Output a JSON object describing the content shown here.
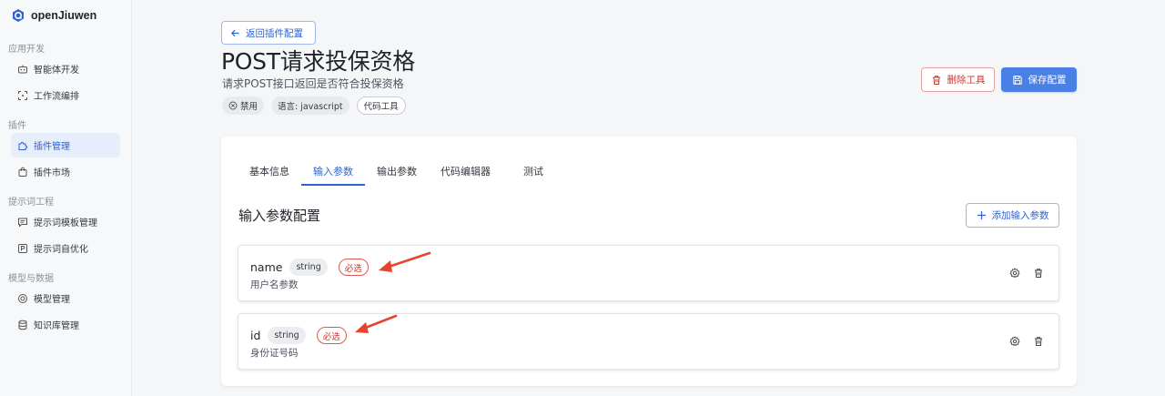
{
  "app": {
    "name": "openJiuwen"
  },
  "sidebar": {
    "groups": [
      {
        "label": "应用开发",
        "items": [
          {
            "label": "智能体开发",
            "icon": "robot-icon"
          },
          {
            "label": "工作流编排",
            "icon": "workflow-icon"
          }
        ]
      },
      {
        "label": "插件",
        "items": [
          {
            "label": "插件管理",
            "icon": "plugin-icon",
            "active": true
          },
          {
            "label": "插件市场",
            "icon": "shopping-bag-icon"
          }
        ]
      },
      {
        "label": "提示词工程",
        "items": [
          {
            "label": "提示词模板管理",
            "icon": "chat-icon"
          },
          {
            "label": "提示词自优化",
            "icon": "prompt-optimize-icon"
          }
        ]
      },
      {
        "label": "模型与数据",
        "items": [
          {
            "label": "模型管理",
            "icon": "model-icon"
          },
          {
            "label": "知识库管理",
            "icon": "database-icon"
          }
        ]
      }
    ]
  },
  "header": {
    "back_label": "返回插件配置",
    "title": "POST请求投保资格",
    "description": "请求POST接口返回是否符合投保资格",
    "chips": [
      {
        "label": "禁用"
      },
      {
        "label": "语言: javascript"
      },
      {
        "label": "代码工具"
      }
    ],
    "delete_label": "删除工具",
    "save_label": "保存配置"
  },
  "tabs": [
    {
      "label": "基本信息"
    },
    {
      "label": "输入参数",
      "active": true
    },
    {
      "label": "输出参数"
    },
    {
      "label": "代码编辑器"
    },
    {
      "label": "测试"
    }
  ],
  "section": {
    "title": "输入参数配置",
    "add_label": "添加输入参数"
  },
  "params": [
    {
      "name": "name",
      "type": "string",
      "required_label": "必选",
      "description": "用户名参数"
    },
    {
      "name": "id",
      "type": "string",
      "required_label": "必选",
      "description": "身份证号码"
    }
  ],
  "colors": {
    "accent": "#2f63d4",
    "primary_button": "#4a7fe6",
    "danger": "#c8382f",
    "annotation_arrow": "#e8432f"
  }
}
